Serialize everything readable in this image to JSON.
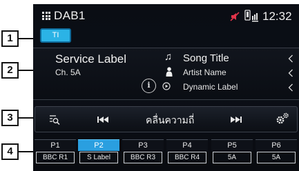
{
  "status_bar": {
    "source": "DAB1",
    "time": "12:32",
    "icons": [
      "grid-menu-icon",
      "mute-icon",
      "phone-battery-icon"
    ]
  },
  "ti_badge": "TI",
  "info": {
    "service_label": "Service Label",
    "channel": "Ch. 5A",
    "song_title": "Song Title",
    "artist_name": "Artist Name",
    "dynamic_label": "Dynamic Label",
    "info_icon_glyph": "i",
    "icons": [
      "music-note-icon",
      "person-icon",
      "info-icon",
      "play-circle-icon",
      "chevron-left-icon"
    ]
  },
  "controls": {
    "frequency_label": "คลื่นความถี่",
    "icons": [
      "search-list-icon",
      "previous-icon",
      "next-icon",
      "settings-icon"
    ]
  },
  "presets": [
    {
      "number": "P1",
      "name": "BBC R1",
      "active": false
    },
    {
      "number": "P2",
      "name": "S Label",
      "active": true
    },
    {
      "number": "P3",
      "name": "BBC R3",
      "active": false
    },
    {
      "number": "P4",
      "name": "BBC R4",
      "active": false
    },
    {
      "number": "P5",
      "name": "5A",
      "active": false
    },
    {
      "number": "P6",
      "name": "5A",
      "active": false
    }
  ],
  "callouts": [
    "1",
    "2",
    "3",
    "4"
  ],
  "colors": {
    "accent": "#2a9fe0",
    "ti_badge": "#2bb3e6",
    "mute_icon": "#e0344a",
    "background": "#0a0d14"
  }
}
